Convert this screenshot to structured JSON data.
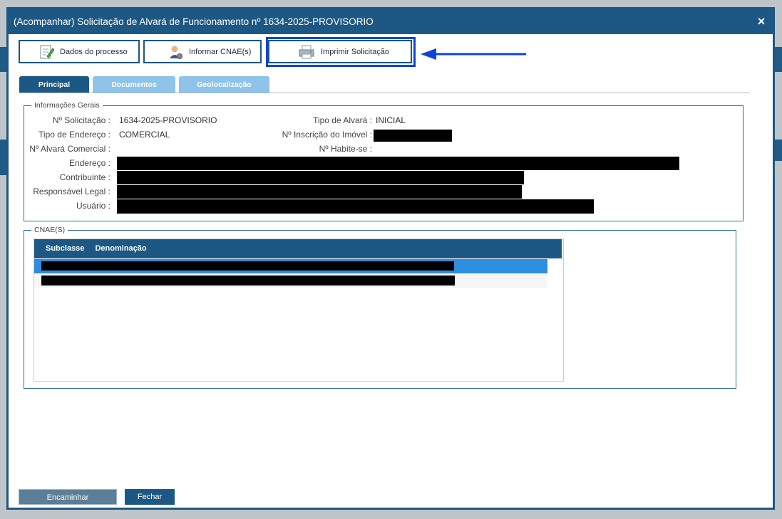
{
  "modal": {
    "title": "(Acompanhar) Solicitação de Alvará de Funcionamento nº 1634-2025-PROVISORIO",
    "close_label": "×"
  },
  "toolbar": {
    "buttons": [
      {
        "label": "Dados do processo",
        "icon": "document-edit-icon"
      },
      {
        "label": "Informar CNAE(s)",
        "icon": "user-gear-icon"
      },
      {
        "label": "Imprimir Solicitação",
        "icon": "printer-icon"
      }
    ]
  },
  "tabs": [
    {
      "label": "Principal",
      "active": true
    },
    {
      "label": "Documentos",
      "active": false
    },
    {
      "label": "Geolocalização",
      "active": false
    }
  ],
  "info": {
    "legend": "Informações Gerais",
    "n_solicitacao_label": "Nº Solicitação :",
    "n_solicitacao_value": "1634-2025-PROVISORIO",
    "tipo_alvara_label": "Tipo de Alvará :",
    "tipo_alvara_value": "INICIAL",
    "tipo_endereco_label": "Tipo de Endereço :",
    "tipo_endereco_value": "COMERCIAL",
    "inscricao_label": "Nº Inscrição do Imóvel :",
    "alvara_comercial_label": "Nº Alvará Comercial :",
    "habite_se_label": "Nº Habite-se :",
    "endereco_label": "Endereço :",
    "contribuinte_label": "Contribuinte :",
    "responsavel_label": "Responsável Legal :",
    "usuario_label": "Usuário :"
  },
  "cnae": {
    "legend": "CNAE(S)",
    "columns": [
      "Subclasse",
      "Denominação"
    ]
  },
  "footer": {
    "encaminhar_label": "Encaminhar",
    "fechar_label": "Fechar"
  },
  "colors": {
    "primary": "#1d5884",
    "tab_inactive": "#8ec4ea",
    "selected_row": "#2d8ee0",
    "highlight_border": "#0b44d6"
  }
}
